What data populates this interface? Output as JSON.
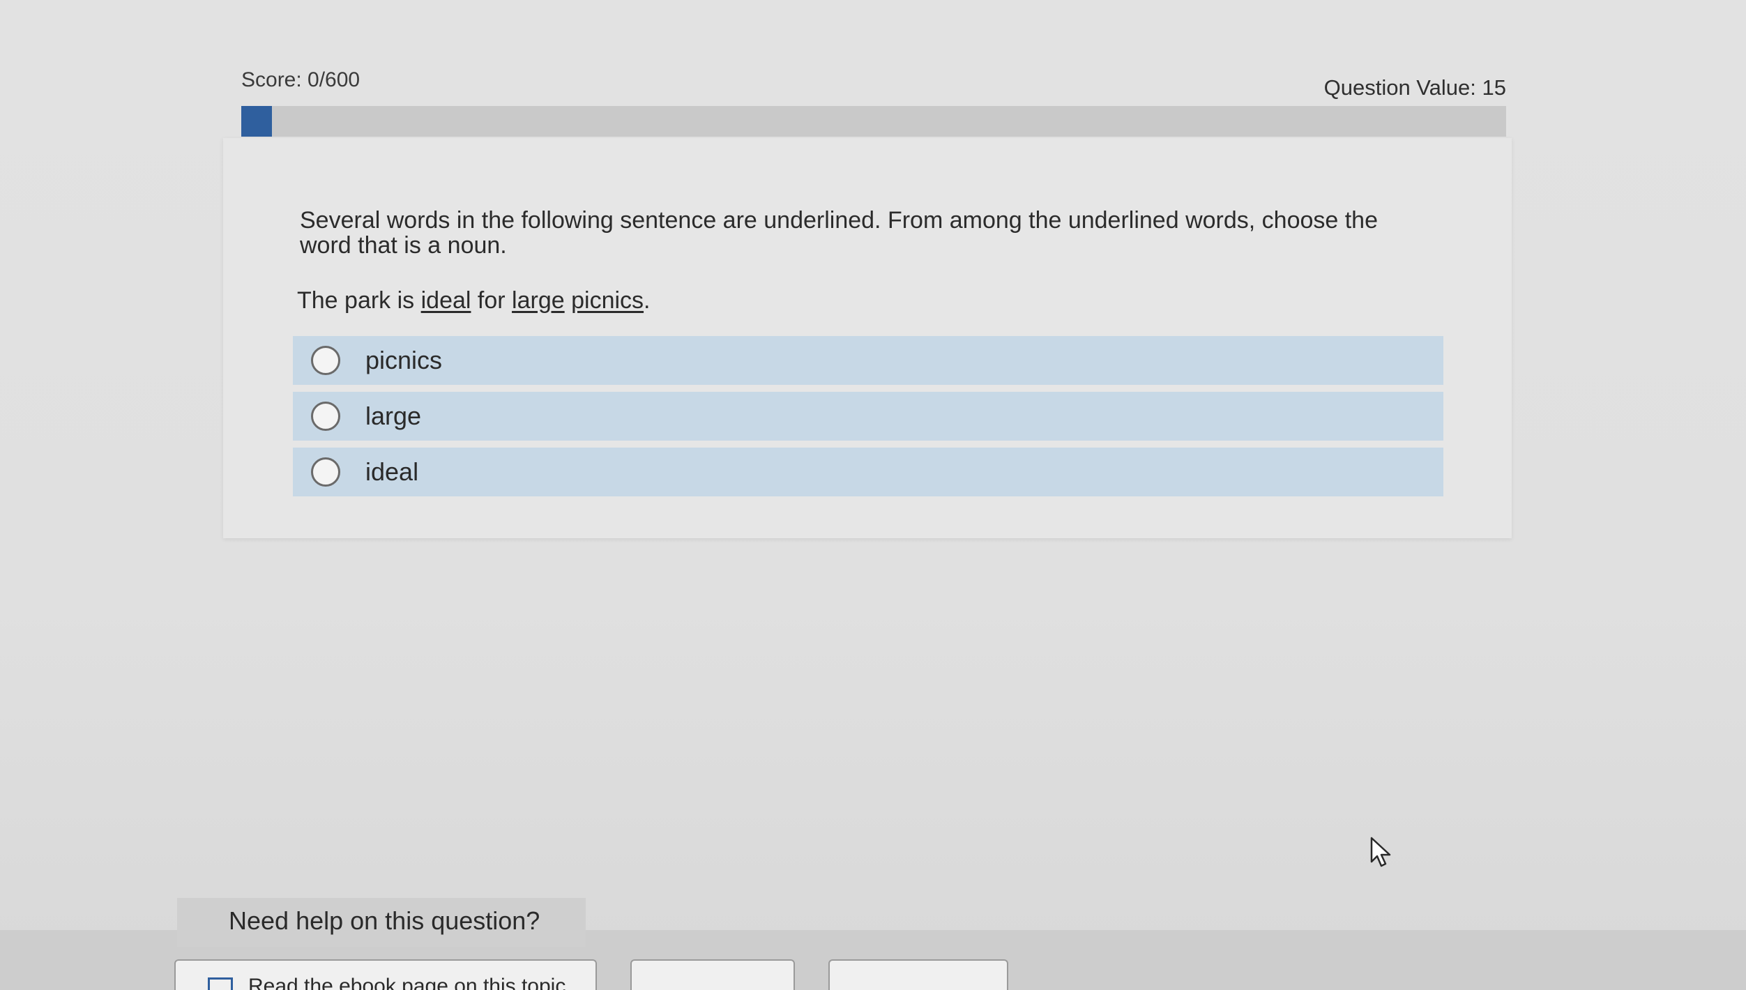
{
  "header": {
    "score_label": "Score: 0/600",
    "question_value_label": "Question Value: 15",
    "progress_fraction": 0.024
  },
  "question": {
    "prompt": "Several words in the following sentence are underlined. From among the underlined words, choose the word that is a noun.",
    "sentence": {
      "part1": "The park is ",
      "underlined1": "ideal",
      "part2": " for ",
      "underlined2": "large",
      "part3": " ",
      "underlined3": "picnics",
      "part4": "."
    },
    "options": [
      {
        "label": "picnics"
      },
      {
        "label": "large"
      },
      {
        "label": "ideal"
      }
    ]
  },
  "help": {
    "tab_label": "Need help on this question?",
    "ebook_label": "Read the ebook page on this topic"
  },
  "colors": {
    "progress": "#2f5f9e",
    "option_bg": "#c7d8e6"
  },
  "icons": {
    "ebook": "book-icon",
    "cursor": "mouse-pointer-icon"
  }
}
